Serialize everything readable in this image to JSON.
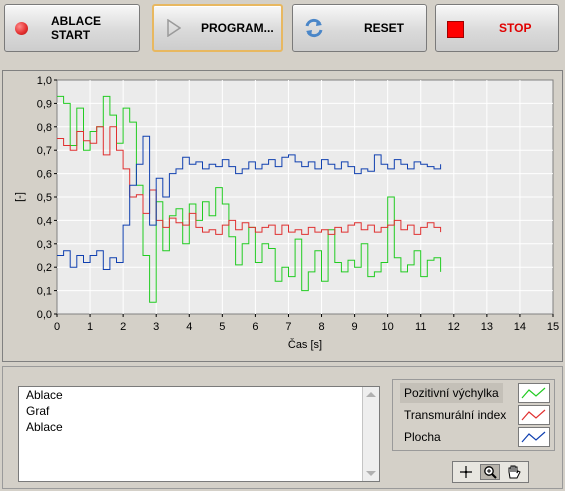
{
  "toolbar": {
    "ablation_start": {
      "label": "ABLACE START",
      "icon": "red-circle-icon",
      "color": "#e53333"
    },
    "program": {
      "label": "PROGRAM...",
      "icon": "play-triangle-icon"
    },
    "reset": {
      "label": "RESET",
      "icon": "refresh-arrows-icon"
    },
    "stop": {
      "label": "STOP",
      "icon": "red-square-icon",
      "color": "#ff0000"
    }
  },
  "chart_data": {
    "type": "line",
    "title": "",
    "xlabel": "Čas [s]",
    "ylabel": "[-]",
    "xlim": [
      0,
      15
    ],
    "ylim": [
      0,
      1
    ],
    "x_ticks": [
      "0",
      "1",
      "2",
      "3",
      "4",
      "5",
      "6",
      "7",
      "8",
      "9",
      "10",
      "11",
      "12",
      "13",
      "14",
      "15"
    ],
    "y_ticks": [
      "0,0",
      "0,1",
      "0,2",
      "0,3",
      "0,4",
      "0,5",
      "0,6",
      "0,7",
      "0,8",
      "0,9",
      "1,0"
    ],
    "grid": true,
    "series": [
      {
        "name": "Pozitivní výchylka",
        "color": "#22cc22",
        "x": [
          0,
          0.2,
          0.4,
          0.6,
          0.8,
          1.0,
          1.2,
          1.4,
          1.6,
          1.8,
          2.0,
          2.2,
          2.4,
          2.6,
          2.8,
          3.0,
          3.2,
          3.4,
          3.6,
          3.8,
          4.0,
          4.2,
          4.4,
          4.6,
          4.8,
          5.0,
          5.2,
          5.4,
          5.6,
          5.8,
          6.0,
          6.2,
          6.4,
          6.6,
          6.8,
          7.0,
          7.2,
          7.4,
          7.6,
          7.8,
          8.0,
          8.2,
          8.4,
          8.6,
          8.8,
          9.0,
          9.2,
          9.4,
          9.6,
          9.8,
          10.0,
          10.2,
          10.4,
          10.6,
          10.8,
          11.0,
          11.2,
          11.4,
          11.6
        ],
        "y": [
          0.93,
          0.9,
          0.72,
          0.88,
          0.7,
          0.78,
          0.8,
          0.93,
          0.85,
          0.73,
          0.88,
          0.82,
          0.55,
          0.25,
          0.05,
          0.48,
          0.27,
          0.42,
          0.45,
          0.3,
          0.47,
          0.4,
          0.48,
          0.42,
          0.54,
          0.47,
          0.33,
          0.21,
          0.3,
          0.37,
          0.22,
          0.3,
          0.28,
          0.14,
          0.2,
          0.16,
          0.32,
          0.1,
          0.18,
          0.27,
          0.14,
          0.36,
          0.22,
          0.18,
          0.23,
          0.2,
          0.3,
          0.16,
          0.18,
          0.22,
          0.5,
          0.24,
          0.18,
          0.21,
          0.27,
          0.16,
          0.23,
          0.24,
          0.18
        ]
      },
      {
        "name": "Transmurální index",
        "color": "#e03030",
        "x": [
          0,
          0.2,
          0.4,
          0.6,
          0.8,
          1.0,
          1.2,
          1.4,
          1.6,
          1.8,
          2.0,
          2.2,
          2.4,
          2.6,
          2.8,
          3.0,
          3.2,
          3.4,
          3.6,
          3.8,
          4.0,
          4.2,
          4.4,
          4.6,
          4.8,
          5.0,
          5.2,
          5.4,
          5.6,
          5.8,
          6.0,
          6.2,
          6.4,
          6.6,
          6.8,
          7.0,
          7.2,
          7.4,
          7.6,
          7.8,
          8.0,
          8.2,
          8.4,
          8.6,
          8.8,
          9.0,
          9.2,
          9.4,
          9.6,
          9.8,
          10.0,
          10.2,
          10.4,
          10.6,
          10.8,
          11.0,
          11.2,
          11.4,
          11.6
        ],
        "y": [
          0.75,
          0.72,
          0.7,
          0.78,
          0.74,
          0.73,
          0.8,
          0.68,
          0.8,
          0.7,
          0.62,
          0.5,
          0.51,
          0.43,
          0.53,
          0.4,
          0.37,
          0.41,
          0.39,
          0.38,
          0.43,
          0.37,
          0.35,
          0.36,
          0.34,
          0.38,
          0.4,
          0.36,
          0.39,
          0.37,
          0.35,
          0.37,
          0.38,
          0.34,
          0.38,
          0.35,
          0.36,
          0.34,
          0.37,
          0.35,
          0.36,
          0.34,
          0.37,
          0.35,
          0.38,
          0.39,
          0.36,
          0.38,
          0.35,
          0.37,
          0.38,
          0.4,
          0.36,
          0.38,
          0.34,
          0.37,
          0.39,
          0.37,
          0.35
        ]
      },
      {
        "name": "Plocha",
        "color": "#1040b0",
        "x": [
          0,
          0.2,
          0.4,
          0.6,
          0.8,
          1.0,
          1.2,
          1.4,
          1.6,
          1.8,
          2.0,
          2.2,
          2.4,
          2.6,
          2.8,
          3.0,
          3.2,
          3.4,
          3.6,
          3.8,
          4.0,
          4.2,
          4.4,
          4.6,
          4.8,
          5.0,
          5.2,
          5.4,
          5.6,
          5.8,
          6.0,
          6.2,
          6.4,
          6.6,
          6.8,
          7.0,
          7.2,
          7.4,
          7.6,
          7.8,
          8.0,
          8.2,
          8.4,
          8.6,
          8.8,
          9.0,
          9.2,
          9.4,
          9.6,
          9.8,
          10.0,
          10.2,
          10.4,
          10.6,
          10.8,
          11.0,
          11.2,
          11.4,
          11.6
        ],
        "y": [
          0.25,
          0.27,
          0.2,
          0.25,
          0.22,
          0.25,
          0.27,
          0.19,
          0.24,
          0.22,
          0.38,
          0.55,
          0.64,
          0.76,
          0.38,
          0.58,
          0.5,
          0.6,
          0.62,
          0.67,
          0.64,
          0.65,
          0.62,
          0.64,
          0.63,
          0.66,
          0.63,
          0.6,
          0.62,
          0.65,
          0.62,
          0.64,
          0.66,
          0.63,
          0.67,
          0.68,
          0.65,
          0.63,
          0.65,
          0.62,
          0.66,
          0.64,
          0.62,
          0.65,
          0.63,
          0.6,
          0.62,
          0.61,
          0.68,
          0.64,
          0.62,
          0.66,
          0.64,
          0.62,
          0.65,
          0.64,
          0.63,
          0.62,
          0.64
        ]
      }
    ]
  },
  "list": {
    "items": [
      {
        "label": "Ablace",
        "selected": false
      },
      {
        "label": "Graf",
        "selected": true
      },
      {
        "label": "Ablace",
        "selected": false
      }
    ],
    "selected_color": "#f8b800"
  },
  "legend": {
    "items": [
      {
        "label": "Pozitivní výchylka",
        "color": "#22cc22"
      },
      {
        "label": "Transmurální index",
        "color": "#e03030"
      },
      {
        "label": "Plocha",
        "color": "#1040b0"
      }
    ]
  },
  "graph_palette": {
    "tools": [
      "crosshair-icon",
      "zoom-magnifier-icon",
      "pan-hand-icon"
    ]
  }
}
